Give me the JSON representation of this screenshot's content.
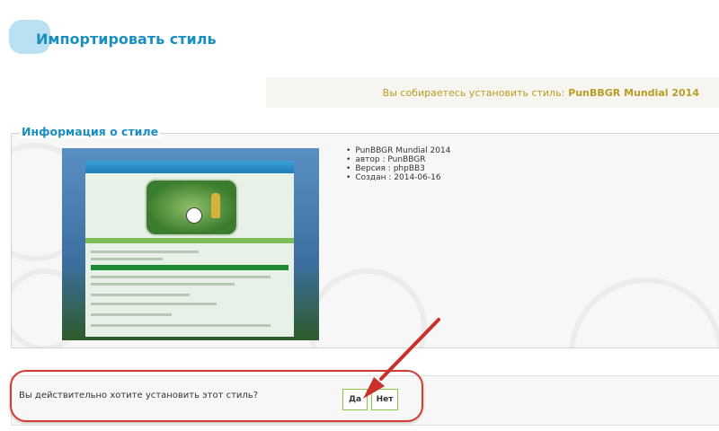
{
  "page": {
    "title": "Импортировать стиль"
  },
  "notice": {
    "text": "Вы собираетесь установить стиль:",
    "style_name": "PunBBGR Mundial 2014"
  },
  "info": {
    "legend": "Информация о стиле",
    "items": [
      "PunBBGR Mundial 2014",
      "автор : PunBBGR",
      "Версия : phpBB3",
      "Создан : 2014-06-16"
    ]
  },
  "confirm": {
    "question": "Вы действительно хотите установить этот стиль?",
    "yes_label": "Да",
    "no_label": "Нет"
  },
  "colors": {
    "title": "#1a8fbf",
    "notice_text": "#b99d27",
    "button_border": "#8bc44a",
    "annotation_red": "#d43b33"
  },
  "annotations": {
    "arrow_icon": "red-arrow-icon",
    "highlight": "red-oval"
  }
}
